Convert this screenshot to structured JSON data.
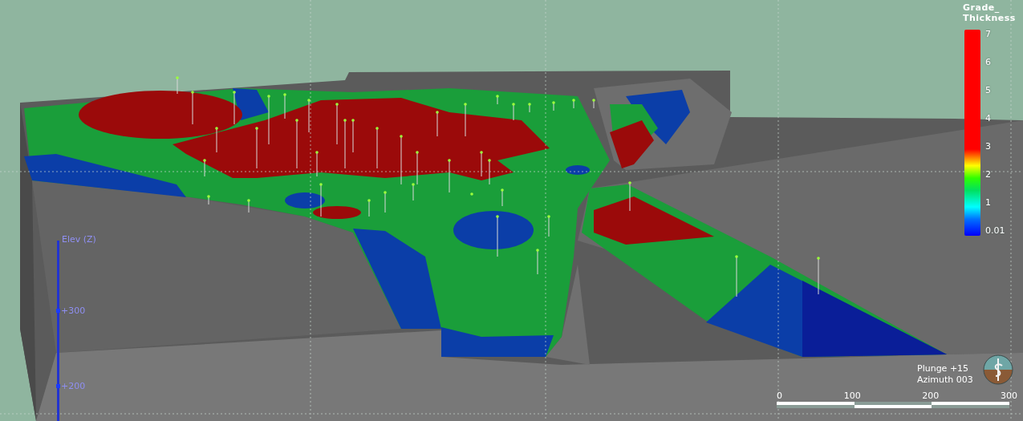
{
  "viewport": {
    "legend": {
      "title_lines": [
        "Grade_",
        "Thickness"
      ],
      "ticks": [
        "7",
        "6",
        "5",
        "4",
        "3",
        "2",
        "1",
        "0.01"
      ]
    },
    "elevation_axis": {
      "label": "Elev (Z)",
      "ticks": [
        "+300",
        "+200"
      ]
    },
    "orientation": {
      "plunge": "Plunge +15",
      "azimuth": "Azimuth 003"
    },
    "scale_bar": {
      "labels": [
        "0",
        "100",
        "200",
        "300"
      ]
    }
  }
}
